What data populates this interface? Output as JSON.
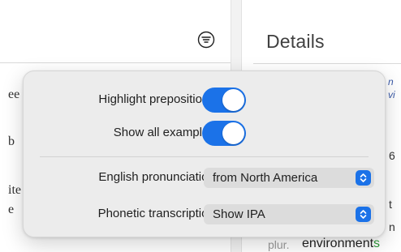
{
  "toolbar": {
    "filter_icon": "filter-icon"
  },
  "details": {
    "title": "Details"
  },
  "background_text": {
    "right_frag_1": "n",
    "right_frag_2": "vi",
    "right_frag_3": "6",
    "right_frag_4": "t",
    "right_frag_5": "n",
    "plur_label": "plur.",
    "plur_word_stem": "environment",
    "plur_word_suffix": "s",
    "left_frag_1": "ee",
    "left_frag_2": "b",
    "left_frag_3": "ite",
    "left_frag_4": "e"
  },
  "popover": {
    "highlight_prepositions": {
      "label": "Highlight prepositions:",
      "on": true
    },
    "show_all_examples": {
      "label": "Show all examples:",
      "on": true
    },
    "english_pronunciation": {
      "label": "English pronunciation:",
      "value": "from North America"
    },
    "phonetic_transcription": {
      "label": "Phonetic transcription:",
      "value": "Show IPA"
    }
  },
  "colors": {
    "accent": "#1b72e8",
    "popover_bg": "#ececec",
    "suffix_green": "#2e9a3a"
  }
}
